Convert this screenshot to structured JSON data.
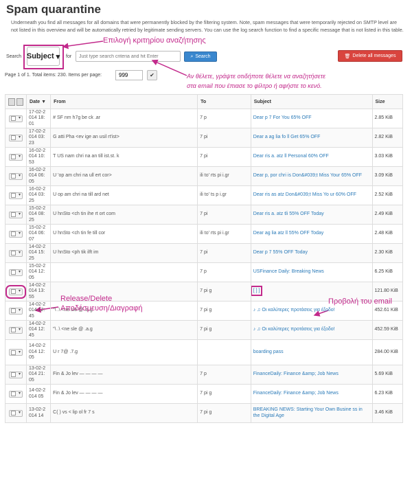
{
  "page": {
    "title": "Spam quarantine",
    "description": "Underneath you find all messages for all domains that were permanently blocked by the filtering system. Note, spam messages that were temporarily rejected on SMTP level are not listed in this overview and will be automatically retried by legitimate sending servers. You can use the log search function to find a specific message that is not listed in this table."
  },
  "search": {
    "label": "Search",
    "for_label": "for",
    "criteria_value": "Subject",
    "placeholder": "Just type search criteria and hit Enter",
    "button_label": "Search"
  },
  "delete_all_label": "Delete all messages",
  "pager": {
    "text": "Page 1 of 1. Total items: 230. Items per page:",
    "per_page": "999"
  },
  "annotations": {
    "criteria": "Επιλογή κριτηρίου αναζήτησης",
    "search_line1": "Αν θέλετε, γράψτε οτιδήποτε θέλετε να αναζητήσετε",
    "search_line2": "στα email που έπιασε το φίλτρο ή αφήστε το κενό.",
    "release_line1": "Release/Delete",
    "release_line2": "Αποδέσμευση/Διαγραφή",
    "view_email": "Προβολή του email"
  },
  "table": {
    "columns": [
      "Date ▼",
      "From",
      "To",
      "Subject",
      "Size"
    ],
    "rows": [
      {
        "date": "17-02-2 014 18: 01",
        "from": "# SF nm h7g be ck .ar",
        "to": "7 p",
        "subject": "Dear p 7 For You 65% OFF",
        "size": "2.85 KiB"
      },
      {
        "date": "17-02-2 014 03: 23",
        "from": "G atti Pha <ev ige an usil rt'ist>",
        "to": "7 pi",
        "subject": "Dear a ag lia fo ll Get 65% OFF",
        "size": "2.82 KiB"
      },
      {
        "date": "16-02-2 014 10: 53",
        "from": "T US nam chri na an till ist.st. k",
        "to": "7 pi",
        "subject": "Dear ris a. atz ll Personal 60% OFF",
        "size": "3.03 KiB"
      },
      {
        "date": "16-02-2 014 06: 05",
        "from": "U 'op am chri na ull ert cor>",
        "to": "ili to' rts pi i.gr",
        "subject": "Dear p, por chri is Don&#039;t Miss Your 65% OFF",
        "size": "3.09 KiB"
      },
      {
        "date": "16-02-2 014 03: 25",
        "from": "U op am chri na till ard net",
        "to": "ili to' ts p i.gr",
        "subject": "Dear ris as atz Don&#039;t Miss Yo ur 60% OFF",
        "size": "2.52 KiB"
      },
      {
        "date": "15-02-2 014 08: 25",
        "from": "U hnSto <ch tin ihe rt ort com",
        "to": "7 pi",
        "subject": "Dear ris a. atz tli 55% OFF Today",
        "size": "2.49 KiB"
      },
      {
        "date": "15-02-2 014 06: 07",
        "from": "U hnSto <ch tin fe till cor",
        "to": "ili to' rts pi i.gr",
        "subject": "Dear ag lia atz ll 55% OFF Today",
        "size": "2.48 KiB"
      },
      {
        "date": "14-02-2 014 15: 25",
        "from": "U hnSto <ph tik ilft im",
        "to": "7 pi",
        "subject": "Dear p 7 55% OFF Today",
        "size": "2.30 KiB"
      },
      {
        "date": "15-02-2 014 12: 05",
        "from": "",
        "to": "7 p",
        "subject": "USFinance Daily: Breaking News",
        "size": "6.25 KiB"
      },
      {
        "date": "14-02-2 014 13: 55",
        "from": "",
        "to": "7 pi g",
        "subject": "[  ] ]",
        "size": "121.80 KiB"
      },
      {
        "date": "14-02-2 014 12: 45",
        "from": "\"\\ .\\ <ne sle @ .a.g",
        "to": "7 pi g",
        "subject": "♪ ♫ Οι καλύτερες προτάσεις για έξοδο!",
        "size": "452.61 KiB"
      },
      {
        "date": "14-02-2 014 12: 45",
        "from": "\"\\ .\\ <ne sle @ .a.g",
        "to": "7 pi g",
        "subject": "♪ ♫ Οι καλύτερες προτάσεις για έξοδο!",
        "size": "452.59 KiB"
      },
      {
        "date": "14-02-2 014 12: 05",
        "from": "U r 7@ .7.g",
        "to": "",
        "subject": "boarding pass",
        "size": "284.00 KiB"
      },
      {
        "date": "13-02-2 014 21: 05",
        "from": "Fin & Jo lev — — — —",
        "to": "7 p",
        "subject": "FinanceDaily: Finance &amp; Job News",
        "size": "5.69 KiB"
      },
      {
        "date": "14-02-2 014 05",
        "from": "Fin & Jo lev — — — —",
        "to": "7 pi g",
        "subject": "FinanceDaily: Finance &amp; Job News",
        "size": "6.23 KiB"
      },
      {
        "date": "13-02-2 014 14",
        "from": "C( ) vs < lip ol fr 7 s",
        "to": "7 pi g",
        "subject": "BREAKING NEWS: Starting Your Own Busine ss in the Digital Age",
        "size": "3.46 KiB"
      }
    ]
  }
}
